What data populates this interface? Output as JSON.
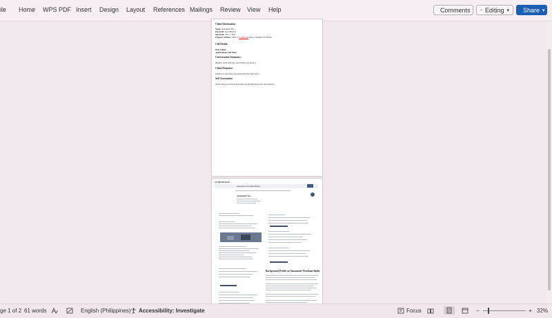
{
  "ribbon": {
    "tabs": [
      "ile",
      "Home",
      "WPS PDF",
      "Insert",
      "Design",
      "Layout",
      "References",
      "Mailings",
      "Review",
      "View",
      "Help"
    ],
    "comments_label": "Comments",
    "editing_label": "Editing",
    "share_label": "Share"
  },
  "document": {
    "page1": {
      "section_client": "Client Information",
      "name_label": "Name:",
      "name_value": "Annamarie Ha...",
      "parcel_label": "Parcel ID:",
      "parcel_value": "0xx-0000-0-1",
      "sale_label": "Sale Date:",
      "sale_value": "June 1, 2023",
      "address_label": "Property Address:",
      "address_value": "5961 S. ",
      "address_red": "Cornflower",
      "address_rest": " Drive, Chandler, AZ 85249",
      "section_call": "Call Details",
      "date_called": "Date Called:",
      "approx_time": "Approximate Call Time:",
      "section_summary": "Conversation Summary:",
      "summary_text": "[Briefly, write what the conversation was about.]",
      "section_response": "Client Response:",
      "response_text": "[Write how the client responded and what they said.]",
      "section_self": "Self-Assessment:",
      "self_text": "[Write what you noticed and what you thought about the conversation.]"
    },
    "page2": {
      "header": "CX RESOURCE ...",
      "search_text": "Annamarie Woolman Bailey",
      "name_caption": "Annamarie Wo...",
      "bg_title": "Background Profile on Annamarie Woolman Bailey"
    }
  },
  "status": {
    "page": "ge 1 of 2",
    "words": "61 words",
    "language": "English (Philippines)",
    "accessibility": "Accessibility: Investigate",
    "focus": "Focus",
    "zoom_minus": "−",
    "zoom_plus": "+",
    "zoom": "32%"
  }
}
